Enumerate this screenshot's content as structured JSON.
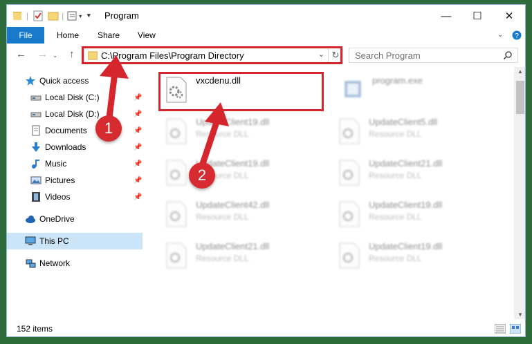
{
  "window": {
    "title": "Program",
    "controls": {
      "minimize": "—",
      "maximize": "☐",
      "close": "✕"
    }
  },
  "ribbon": {
    "tabs": [
      {
        "label": "File"
      },
      {
        "label": "Home"
      },
      {
        "label": "Share"
      },
      {
        "label": "View"
      }
    ],
    "help_icon": "help-icon"
  },
  "navigation": {
    "address": "C:\\Program Files\\Program Directory",
    "search_placeholder": "Search Program"
  },
  "sidebar": {
    "items": [
      {
        "label": "Quick access",
        "icon": "star-icon",
        "pinned": false
      },
      {
        "label": "Local Disk (C:)",
        "icon": "drive-icon",
        "pinned": true
      },
      {
        "label": "Local Disk (D:)",
        "icon": "drive-icon",
        "pinned": true
      },
      {
        "label": "Documents",
        "icon": "documents-icon",
        "pinned": true
      },
      {
        "label": "Downloads",
        "icon": "download-icon",
        "pinned": true
      },
      {
        "label": "Music",
        "icon": "music-icon",
        "pinned": true
      },
      {
        "label": "Pictures",
        "icon": "pictures-icon",
        "pinned": true
      },
      {
        "label": "Videos",
        "icon": "videos-icon",
        "pinned": true
      },
      {
        "label": "OneDrive",
        "icon": "cloud-icon",
        "pinned": false
      },
      {
        "label": "This PC",
        "icon": "computer-icon",
        "pinned": false,
        "selected": true
      },
      {
        "label": "Network",
        "icon": "network-icon",
        "pinned": false
      }
    ]
  },
  "files": [
    {
      "name": "vxcdenu.dll",
      "type": "",
      "highlighted": true
    },
    {
      "name": "program.exe",
      "type": ""
    },
    {
      "name": "UpdateClient19.dll",
      "type": "Resource DLL"
    },
    {
      "name": "UpdateClient5.dll",
      "type": "Resource DLL"
    },
    {
      "name": "UpdateClient19.dll",
      "type": "Resource DLL"
    },
    {
      "name": "UpdateClient21.dll",
      "type": "Resource DLL"
    },
    {
      "name": "UpdateClient42.dll",
      "type": "Resource DLL"
    },
    {
      "name": "UpdateClient19.dll",
      "type": "Resource DLL"
    },
    {
      "name": "UpdateClient21.dll",
      "type": "Resource DLL"
    },
    {
      "name": "UpdateClient19.dll",
      "type": "Resource DLL"
    }
  ],
  "status": {
    "item_count": "152 items"
  },
  "annotations": {
    "step1": "1",
    "step2": "2",
    "color": "#d5262e"
  }
}
